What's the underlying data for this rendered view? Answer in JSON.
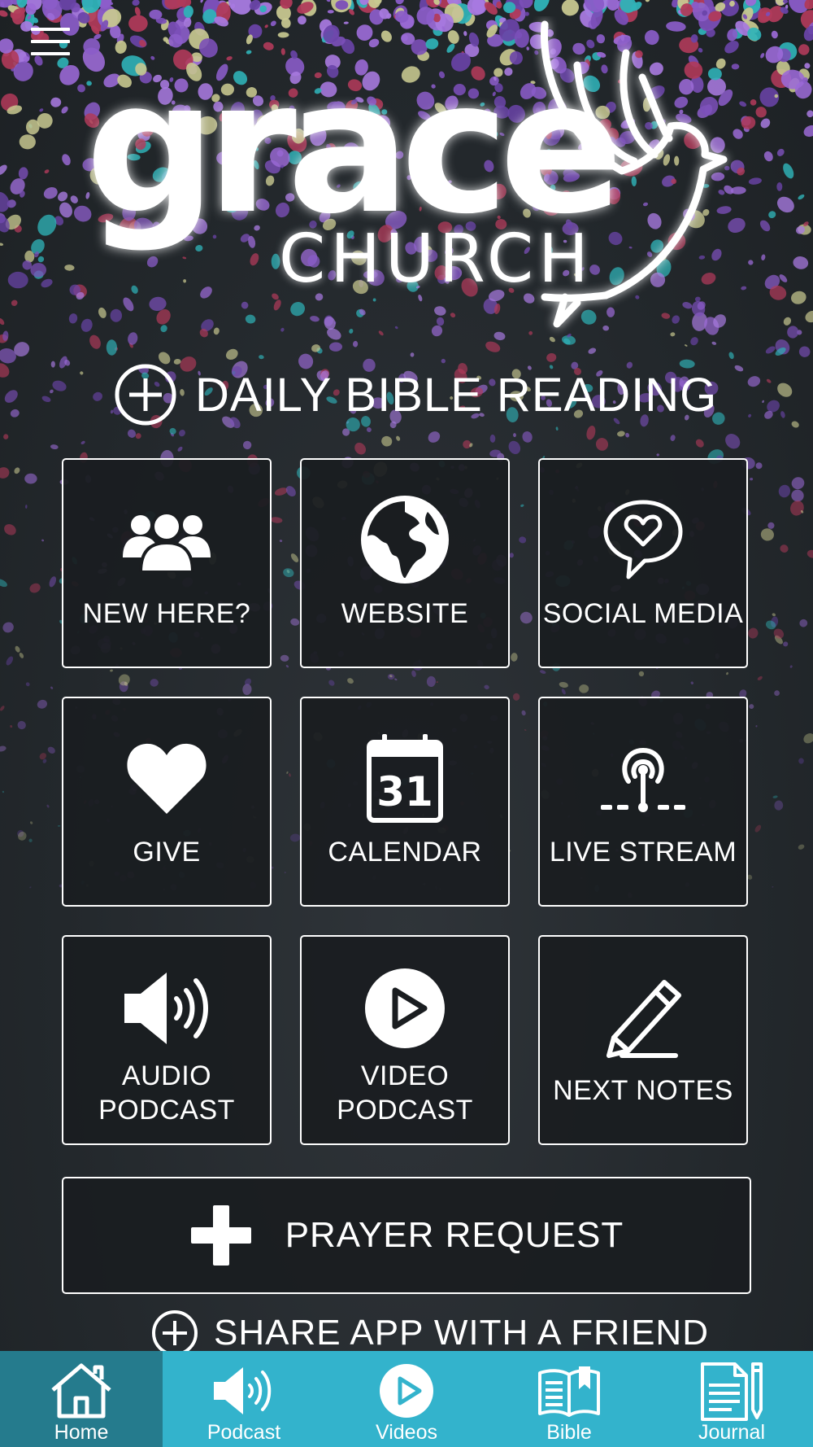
{
  "app": {
    "logo_text": "grace",
    "logo_subtext": "CHURCH"
  },
  "menu": {
    "icon": "hamburger-menu-icon"
  },
  "daily_reading": {
    "label": "DAILY BIBLE READING",
    "icon": "plus-circle-icon"
  },
  "tiles": [
    {
      "label": "NEW HERE?",
      "icon": "people-group-icon"
    },
    {
      "label": "WEBSITE",
      "icon": "globe-icon"
    },
    {
      "label": "SOCIAL MEDIA",
      "icon": "speech-heart-icon"
    },
    {
      "label": "GIVE",
      "icon": "heart-icon"
    },
    {
      "label": "CALENDAR",
      "icon": "calendar-icon",
      "calendar_day": "31"
    },
    {
      "label": "LIVE STREAM",
      "icon": "broadcast-icon"
    },
    {
      "label_line1": "AUDIO",
      "label_line2": "PODCAST",
      "icon": "speaker-icon"
    },
    {
      "label_line1": "VIDEO",
      "label_line2": "PODCAST",
      "icon": "play-circle-icon"
    },
    {
      "label": "NEXT NOTES",
      "icon": "pencil-icon"
    }
  ],
  "prayer_request": {
    "label": "PRAYER REQUEST",
    "icon": "plus-icon"
  },
  "share": {
    "label": "SHARE APP WITH A FRIEND",
    "icon": "plus-circle-icon"
  },
  "tabbar": {
    "items": [
      {
        "label": "Home",
        "icon": "home-icon",
        "active": true
      },
      {
        "label": "Podcast",
        "icon": "speaker-icon"
      },
      {
        "label": "Videos",
        "icon": "play-circle-icon"
      },
      {
        "label": "Bible",
        "icon": "book-icon"
      },
      {
        "label": "Journal",
        "icon": "journal-icon"
      }
    ]
  },
  "colors": {
    "tabbar": "#33b3cc",
    "tabbar_active": "#257b8d",
    "background": "#22272b",
    "tile_fill": "#1a1d20"
  }
}
